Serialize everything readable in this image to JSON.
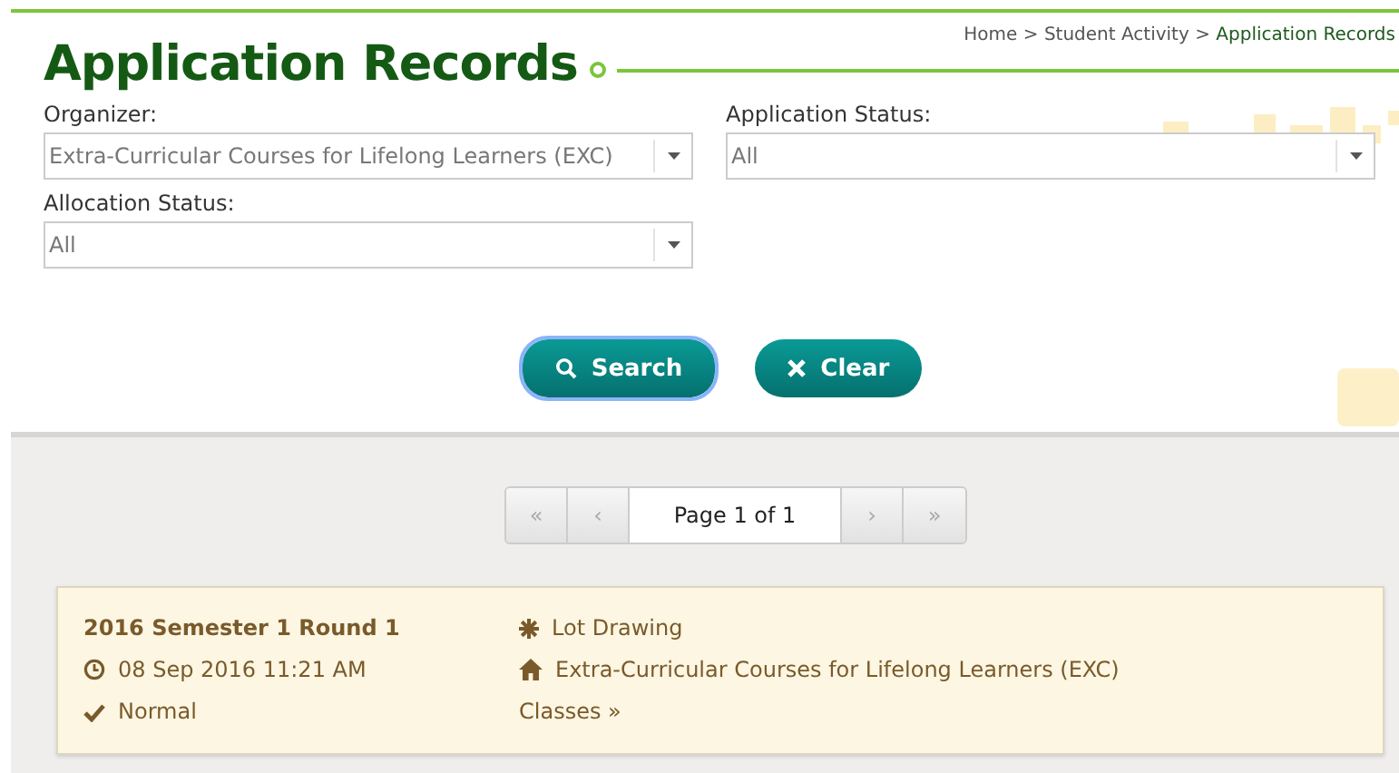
{
  "page": {
    "title": "Application Records"
  },
  "breadcrumb": [
    {
      "label": "Home",
      "current": false
    },
    {
      "label": "Student Activity",
      "current": false
    },
    {
      "label": "Application Records",
      "current": true
    }
  ],
  "breadcrumb_separator": ">",
  "filters": [
    {
      "label": "Organizer:",
      "value": "Extra-Curricular Courses for Lifelong Learners (EXC)"
    },
    {
      "label": "Application Status:",
      "value": "All"
    },
    {
      "label": "Allocation Status:",
      "value": "All"
    }
  ],
  "buttons": [
    {
      "kind": "search",
      "label": "Search",
      "focused": true
    },
    {
      "kind": "clear",
      "label": "Clear",
      "focused": false
    }
  ],
  "pager": {
    "first": "«",
    "prev": "‹",
    "label": "Page 1 of 1",
    "next": "›",
    "last": "»",
    "disabled": true
  },
  "records": [
    {
      "title": "2016 Semester 1 Round 1",
      "datetime": "08 Sep 2016 11:21 AM",
      "status": "Normal",
      "method": "Lot Drawing",
      "organizer": "Extra-Curricular Courses for Lifelong Learners (EXC)",
      "link": "Classes »"
    }
  ]
}
